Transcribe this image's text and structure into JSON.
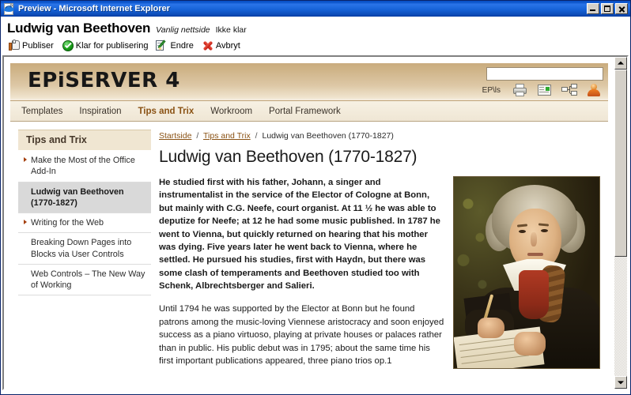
{
  "window": {
    "title": "Preview - Microsoft Internet Explorer",
    "icon": "ie-icon",
    "buttons": {
      "minimize": "minimize",
      "maximize": "maximize",
      "close": "close"
    }
  },
  "editbar": {
    "page_title": "Ludwig van Beethoven",
    "page_type": "Vanlig nettside",
    "page_status": "Ikke klar",
    "commands": [
      {
        "label": "Publiser",
        "icon": "thumbs-up-icon"
      },
      {
        "label": "Klar for publisering",
        "icon": "green-check-icon"
      },
      {
        "label": "Endre",
        "icon": "edit-pencil-icon"
      },
      {
        "label": "Avbryt",
        "icon": "red-x-icon"
      }
    ]
  },
  "site": {
    "logo": "EPiSERVER 4",
    "search": {
      "value": "",
      "placeholder": ""
    },
    "user_label": "EP\\ls",
    "header_icons": [
      {
        "name": "printer-icon"
      },
      {
        "name": "page-icon"
      },
      {
        "name": "sitemap-icon"
      },
      {
        "name": "user-icon"
      }
    ],
    "nav": [
      {
        "label": "Templates",
        "active": false
      },
      {
        "label": "Inspiration",
        "active": false
      },
      {
        "label": "Tips and Trix",
        "active": true
      },
      {
        "label": "Workroom",
        "active": false
      },
      {
        "label": "Portal Framework",
        "active": false
      }
    ],
    "sidebar": {
      "heading": "Tips and Trix",
      "items": [
        {
          "label": "Make the Most of the Office Add-In",
          "arrow": true,
          "selected": false
        },
        {
          "label": "Ludwig van Beethoven (1770-1827)",
          "arrow": false,
          "selected": true
        },
        {
          "label": "Writing for the Web",
          "arrow": true,
          "selected": false
        },
        {
          "label": "Breaking Down Pages into Blocks via User Controls",
          "arrow": false,
          "selected": false
        },
        {
          "label": "Web Controls – The New Way of Working",
          "arrow": false,
          "selected": false
        }
      ]
    },
    "breadcrumb": {
      "items": [
        {
          "label": "Startside",
          "link": true
        },
        {
          "label": "Tips and Trix",
          "link": true
        },
        {
          "label": "Ludwig van Beethoven (1770-1827)",
          "link": false
        }
      ],
      "separator": "/"
    },
    "article": {
      "title": "Ludwig van Beethoven (1770-1827)",
      "image_alt": "Portrait of Ludwig van Beethoven",
      "paragraphs": [
        "He studied first with his father, Johann, a singer and instrumentalist in the service of the Elector of Cologne at Bonn, but mainly with C.G. Neefe, court organist. At 11 ½ he was able to deputize for Neefe; at 12 he had some music published. In 1787 he went to Vienna, but quickly returned on hearing that his mother was dying. Five years later he went back to Vienna, where he settled. He pursued his studies, first with Haydn, but there was some clash of temperaments and Beethoven studied too with Schenk, Albrechtsberger and Salieri.",
        "Until 1794 he was supported by the Elector at Bonn but he found patrons among the music-loving Viennese aristocracy and soon enjoyed success as a piano virtuoso, playing at private houses or palaces rather than in public. His public debut was in 1795; about the same time his first important publications appeared, three piano trios op.1"
      ]
    }
  },
  "scrollbar": {
    "up": "scroll-up",
    "down": "scroll-down",
    "thumb_position": "top"
  },
  "colors": {
    "titlebar": "#0a52c8",
    "accent_brown": "#8a5214",
    "header_tan": "#cfb488",
    "nav_bg": "#f3eadb",
    "sidebar_head": "#f0e6d2",
    "selected_item": "#d9d9d9"
  }
}
